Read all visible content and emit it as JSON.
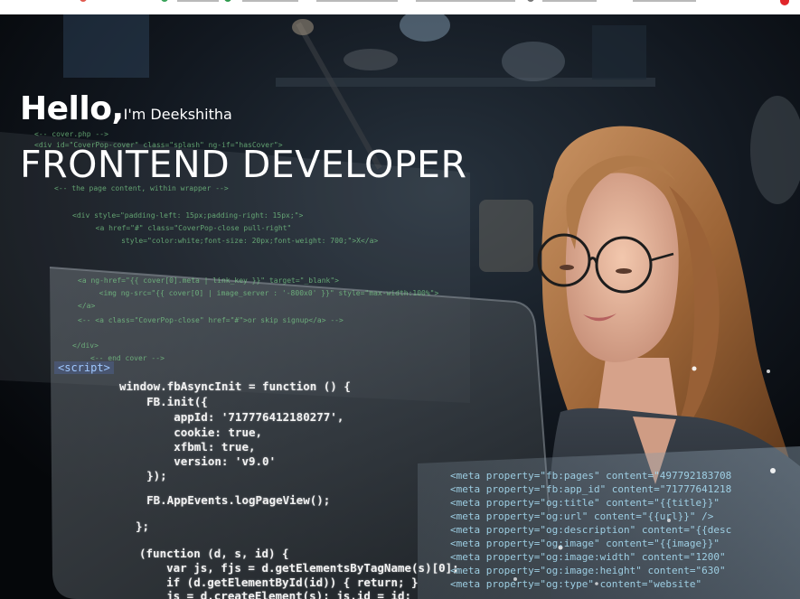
{
  "hero": {
    "greeting": "Hello,",
    "intro": "I'm Deekshitha",
    "role": "FRONTEND DEVELOPER"
  },
  "code_overlay": {
    "back_lines": [
      "<-- cover.php -->",
      "<div id=\"CoverPop-cover\" class=\"splash\" ng-if=\"hasCover\">",
      "<-- the page content, within wrapper -->",
      "<div style=\"padding-left: 15px;padding-right: 15px;\">",
      "  <a href=\"#\" class=\"CoverPop-close pull-right\"",
      "     style=\"color:white;font-size: 20px;font-weight: 700;\">X</a>",
      "<a ng-href=\"{{ cover[0].meta | link_key }}\" target=\"_blank\">",
      "  <img ng-src=\"{{ cover[0] | image_server : '-800x0' }}\" style=\"max-width:100%\">",
      "</a>",
      "<-- <a class=\"CoverPop-close\" href=\"#\">or skip signup</a> -->",
      "</div>",
      "<-- end cover -->"
    ],
    "script_tag": "<script>",
    "front_lines": [
      "window.fbAsyncInit = function () {",
      "    FB.init({",
      "        appId: '717776412180277',",
      "        cookie: true,",
      "        xfbml: true,",
      "        version: 'v9.0'",
      "    });",
      "",
      "    FB.AppEvents.logPageView();",
      "",
      "};",
      "",
      "(function (d, s, id) {",
      "    var js, fjs = d.getElementsByTagName(s)[0];",
      "    if (d.getElementById(id)) { return; }",
      "    js = d.createElement(s); js.id = id;"
    ],
    "meta_lines": [
      "<meta property=\"fb:pages\" content=\"497792183708",
      "<meta property=\"fb:app_id\" content=\"71777641218",
      "<meta property=\"og:title\" content=\"{{title}}\"",
      "<meta property=\"og:url\" content=\"{{url}}\" />",
      "<meta property=\"og:description\" content=\"{{desc",
      "<meta property=\"og:image\" content=\"{{image}}\"",
      "<meta property=\"og:image:width\" content=\"1200\"",
      "<meta property=\"og:image:height\" content=\"630\"",
      "<meta property=\"og:type\" content=\"website\""
    ]
  },
  "colors": {
    "background": "#080b10",
    "heading_text": "#ffffff",
    "code_green": "#7bd08a",
    "code_pink": "#f29ab9",
    "code_blue": "#a7dcf2",
    "hair": "#b57a45",
    "accent_red": "#e0262a"
  }
}
